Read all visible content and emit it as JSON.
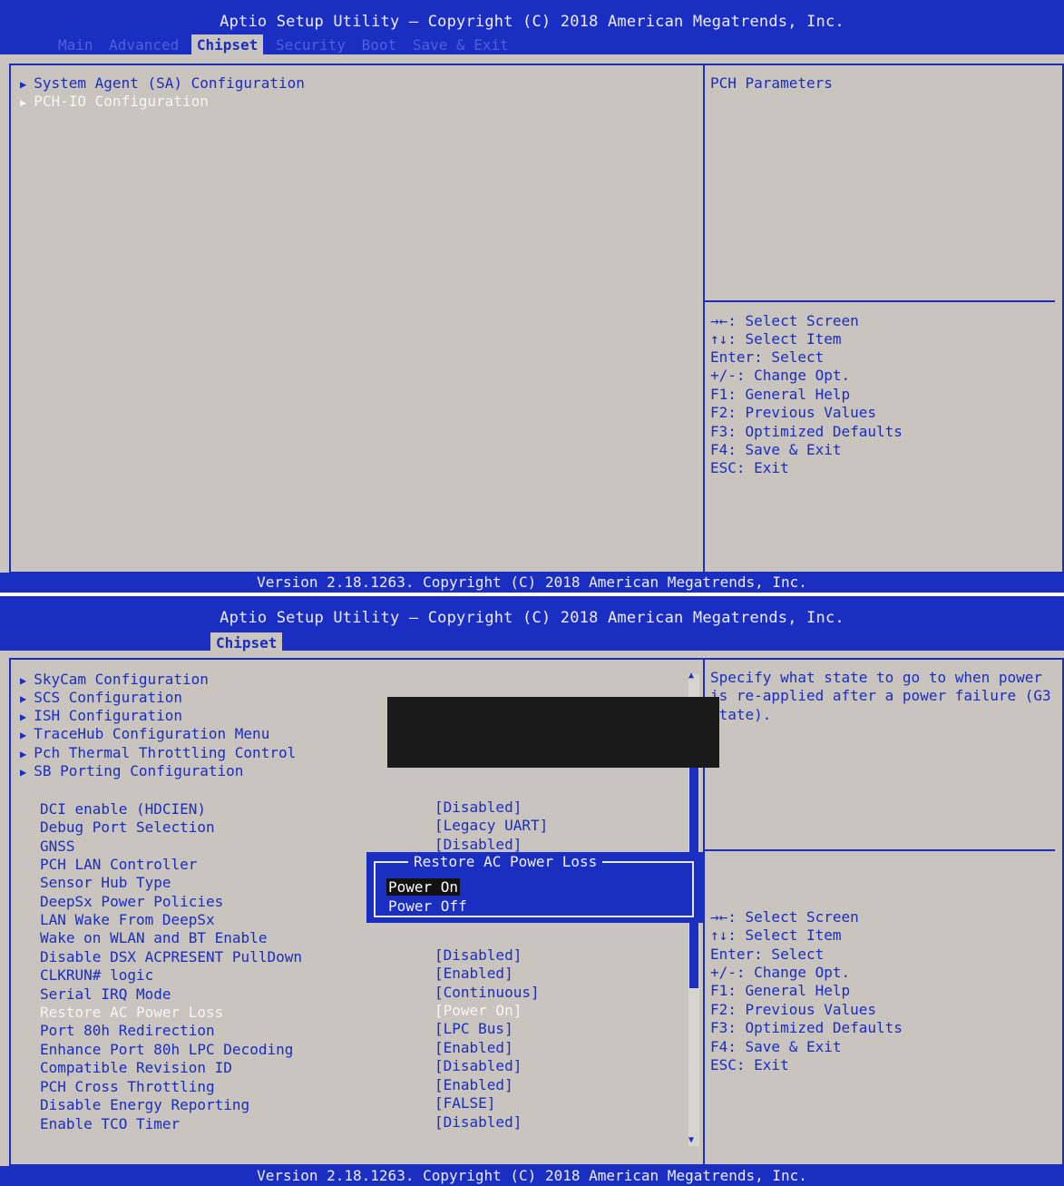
{
  "screen1": {
    "title": "Aptio Setup Utility – Copyright (C) 2018 American Megatrends, Inc.",
    "tabs": [
      "Main",
      "Advanced",
      "Chipset",
      "Security",
      "Boot",
      "Save & Exit"
    ],
    "active_tab": "Chipset",
    "menu": [
      "System Agent (SA) Configuration",
      "PCH-IO Configuration"
    ],
    "description": "PCH Parameters",
    "help": [
      "→←: Select Screen",
      "↑↓: Select Item",
      "Enter: Select",
      "+/-: Change Opt.",
      "F1: General Help",
      "F2: Previous Values",
      "F3: Optimized Defaults",
      "F4: Save & Exit",
      "ESC: Exit"
    ],
    "footer": "Version 2.18.1263. Copyright (C) 2018 American Megatrends, Inc."
  },
  "screen2": {
    "title": "Aptio Setup Utility – Copyright (C) 2018 American Megatrends, Inc.",
    "active_tab": "Chipset",
    "submenus": [
      "SkyCam Configuration",
      "SCS Configuration",
      "ISH Configuration",
      "TraceHub Configuration Menu",
      "Pch Thermal Throttling Control",
      "SB Porting Configuration"
    ],
    "settings": [
      {
        "label": "DCI enable (HDCIEN)",
        "value": "[Disabled]"
      },
      {
        "label": "Debug Port Selection",
        "value": "[Legacy UART]"
      },
      {
        "label": "GNSS",
        "value": "[Disabled]"
      },
      {
        "label": "PCH LAN Controller",
        "value": ""
      },
      {
        "label": "Sensor Hub Type",
        "value": ""
      },
      {
        "label": "DeepSx Power Policies",
        "value": ""
      },
      {
        "label": "LAN Wake From DeepSx",
        "value": ""
      },
      {
        "label": "Wake on WLAN and BT Enable",
        "value": ""
      },
      {
        "label": "Disable DSX ACPRESENT PullDown",
        "value": "[Disabled]"
      },
      {
        "label": "CLKRUN# logic",
        "value": "[Enabled]"
      },
      {
        "label": "Serial IRQ Mode",
        "value": "[Continuous]"
      },
      {
        "label": "Restore AC Power Loss",
        "value": "[Power On]"
      },
      {
        "label": "Port 80h Redirection",
        "value": "[LPC Bus]"
      },
      {
        "label": "Enhance Port 80h LPC Decoding",
        "value": "[Enabled]"
      },
      {
        "label": "Compatible Revision ID",
        "value": "[Disabled]"
      },
      {
        "label": "PCH Cross Throttling",
        "value": "[Enabled]"
      },
      {
        "label": "Disable Energy Reporting",
        "value": "[FALSE]"
      },
      {
        "label": "Enable TCO Timer",
        "value": "[Disabled]"
      }
    ],
    "description": "Specify what state to go to when power is re-applied after a power failure (G3 state).",
    "help": [
      "→←: Select Screen",
      "↑↓: Select Item",
      "Enter: Select",
      "+/-: Change Opt.",
      "F1: General Help",
      "F2: Previous Values",
      "F3: Optimized Defaults",
      "F4: Save & Exit",
      "ESC: Exit"
    ],
    "popup": {
      "title": "Restore AC Power Loss",
      "options": [
        "Power On",
        "Power Off"
      ],
      "selected": "Power On"
    },
    "footer": "Version 2.18.1263. Copyright (C) 2018 American Megatrends, Inc."
  },
  "colors": {
    "background": "#c9c4bd",
    "accent": "#1a2ec2",
    "highlight": "#f5f5f5",
    "popup": "#1a2ec2"
  }
}
